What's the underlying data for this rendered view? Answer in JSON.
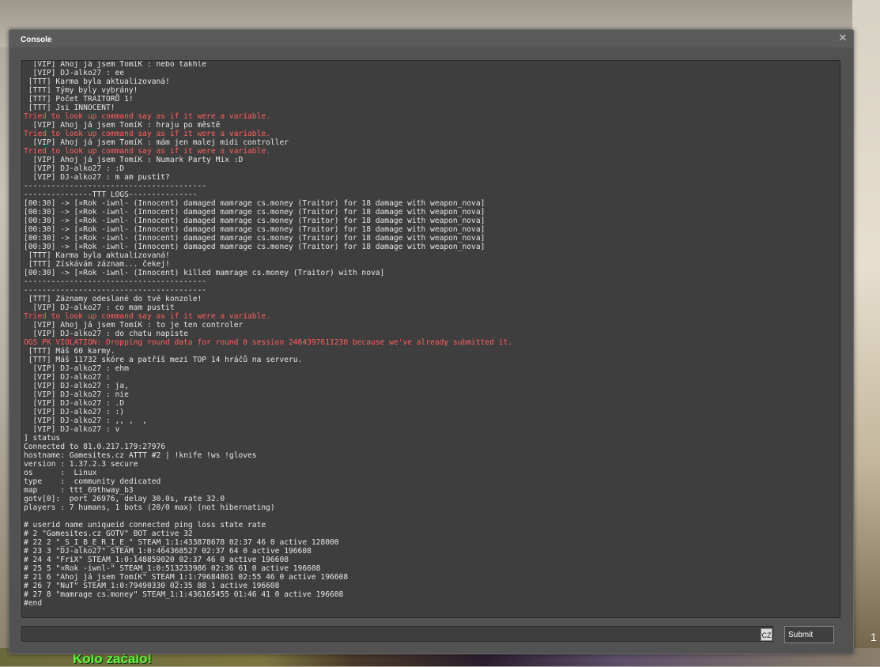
{
  "window": {
    "title": "Console",
    "close_glyph": "✕"
  },
  "console_lines": [
    {
      "text": "  [VIP] Ahoj já jsem TomíK : nebo takhle",
      "type": "normal"
    },
    {
      "text": "  [VIP] DJ-alko27 : ee",
      "type": "normal"
    },
    {
      "text": " [TTT] Karma byla aktualizovaná!",
      "type": "normal"
    },
    {
      "text": " [TTT] Týmy byly vybrány!",
      "type": "normal"
    },
    {
      "text": " [TTT] Počet TRAITORŮ 1!",
      "type": "normal"
    },
    {
      "text": " [TTT] Jsi INNOCENT!",
      "type": "normal"
    },
    {
      "text": "Tried to look up command say as if it were a variable.",
      "type": "error"
    },
    {
      "text": "  [VIP] Ahoj já jsem TomíK : hraju po městě",
      "type": "normal"
    },
    {
      "text": "Tried to look up command say as if it were a variable.",
      "type": "error"
    },
    {
      "text": "  [VIP] Ahoj já jsem TomíK : mám jen malej midi controller",
      "type": "normal"
    },
    {
      "text": "Tried to look up command say as if it were a variable.",
      "type": "error"
    },
    {
      "text": "  [VIP] Ahoj já jsem TomíK : Numark Party Mix :D",
      "type": "normal"
    },
    {
      "text": "  [VIP] DJ-alko27 : :D",
      "type": "normal"
    },
    {
      "text": "  [VIP] DJ-alko27 : m am pustit?",
      "type": "normal"
    },
    {
      "text": "----------------------------------------",
      "type": "normal"
    },
    {
      "text": "---------------TTT LOGS---------------",
      "type": "normal"
    },
    {
      "text": "[00:30] -> [¤Rok -iwnl- (Innocent) damaged mamrage cs.money (Traitor) for 18 damage with weapon_nova]",
      "type": "normal"
    },
    {
      "text": "[00:30] -> [¤Rok -iwnl- (Innocent) damaged mamrage cs.money (Traitor) for 18 damage with weapon_nova]",
      "type": "normal"
    },
    {
      "text": "[00:30] -> [¤Rok -iwnl- (Innocent) damaged mamrage cs.money (Traitor) for 18 damage with weapon_nova]",
      "type": "normal"
    },
    {
      "text": "[00:30] -> [¤Rok -iwnl- (Innocent) damaged mamrage cs.money (Traitor) for 18 damage with weapon_nova]",
      "type": "normal"
    },
    {
      "text": "[00:30] -> [¤Rok -iwnl- (Innocent) damaged mamrage cs.money (Traitor) for 18 damage with weapon_nova]",
      "type": "normal"
    },
    {
      "text": "[00:30] -> [¤Rok -iwnl- (Innocent) damaged mamrage cs.money (Traitor) for 18 damage with weapon_nova]",
      "type": "normal"
    },
    {
      "text": " [TTT] Karma byla aktualizovaná!",
      "type": "normal"
    },
    {
      "text": " [TTT] Získávám záznam... čekej!",
      "type": "normal"
    },
    {
      "text": "[00:30] -> [¤Rok -iwnl- (Innocent) killed mamrage cs.money (Traitor) with nova]",
      "type": "normal"
    },
    {
      "text": "----------------------------------------",
      "type": "normal"
    },
    {
      "text": "----------------------------------------",
      "type": "normal"
    },
    {
      "text": " [TTT] Záznamy odeslané do tvé konzole!",
      "type": "normal"
    },
    {
      "text": "  [VIP] DJ-alko27 : co mam pustit",
      "type": "normal"
    },
    {
      "text": "Tried to look up command say as if it were a variable.",
      "type": "error"
    },
    {
      "text": "  [VIP] Ahoj já jsem TomíK : to je ten controler",
      "type": "normal"
    },
    {
      "text": "  [VIP] DJ-alko27 : do chatu napiste",
      "type": "normal"
    },
    {
      "text": "OGS PK VIOLATION: Dropping round data for round 0 session 2464397611230 because we've already submitted it.",
      "type": "error"
    },
    {
      "text": " [TTT] Máš 60 karmy.",
      "type": "normal"
    },
    {
      "text": " [TTT] Máš 11732 skóre a patříš mezi TOP 14 hráčů na serveru.",
      "type": "normal"
    },
    {
      "text": "  [VIP] DJ-alko27 : ehm",
      "type": "normal"
    },
    {
      "text": "  [VIP] DJ-alko27 :",
      "type": "normal"
    },
    {
      "text": "  [VIP] DJ-alko27 : ja,",
      "type": "normal"
    },
    {
      "text": "  [VIP] DJ-alko27 : nie",
      "type": "normal"
    },
    {
      "text": "  [VIP] DJ-alko27 : .D",
      "type": "normal"
    },
    {
      "text": "  [VIP] DJ-alko27 : :)",
      "type": "normal"
    },
    {
      "text": "  [VIP] DJ-alko27 : ,, ,  ,",
      "type": "normal"
    },
    {
      "text": "  [VIP] DJ-alko27 : v",
      "type": "normal"
    },
    {
      "text": "] status",
      "type": "normal"
    },
    {
      "text": "Connected to 81.0.217.179:27976",
      "type": "normal"
    },
    {
      "text": "hostname: Gamesites.cz ATTT #2 | !knife !ws !gloves",
      "type": "normal"
    },
    {
      "text": "version : 1.37.2.3 secure",
      "type": "normal"
    },
    {
      "text": "os      :  Linux",
      "type": "normal"
    },
    {
      "text": "type    :  community dedicated",
      "type": "normal"
    },
    {
      "text": "map     : ttt_69thway_b3",
      "type": "normal"
    },
    {
      "text": "gotv[0]:  port 26976, delay 30.0s, rate 32.0",
      "type": "normal"
    },
    {
      "text": "players : 7 humans, 1 bots (20/0 max) (not hibernating)",
      "type": "normal"
    },
    {
      "text": "",
      "type": "normal"
    },
    {
      "text": "# userid name uniqueid connected ping loss state rate",
      "type": "normal"
    },
    {
      "text": "# 2 \"Gamesites.cz GOTV\" BOT active 32",
      "type": "normal"
    },
    {
      "text": "# 22 2 \"_S_I_B_E_R_I_E_\" STEAM_1:1:433878678 02:37 46 0 active 128000",
      "type": "normal"
    },
    {
      "text": "# 23 3 \"DJ-alko27\" STEAM_1:0:464368527 02:37 64 0 active 196608",
      "type": "normal"
    },
    {
      "text": "# 24 4 \"FriX\" STEAM_1:0:148859020 02:37 46 0 active 196608",
      "type": "normal"
    },
    {
      "text": "# 25 5 \"¤Rok -iwnl-\" STEAM_1:0:513233986 02:36 61 0 active 196608",
      "type": "normal"
    },
    {
      "text": "# 21 6 \"Ahoj já jsem TomíK\" STEAM_1:1:79684861 02:55 46 0 active 196608",
      "type": "normal"
    },
    {
      "text": "# 26 7 \"NuT\" STEAM_1:0:79490330 02:35 88 1 active 196608",
      "type": "normal"
    },
    {
      "text": "# 27 8 \"mamrage cs.money\" STEAM_1:1:436165455 01:46 41 0 active 196608",
      "type": "normal"
    },
    {
      "text": "#end",
      "type": "normal"
    }
  ],
  "input": {
    "value": "",
    "placeholder": ""
  },
  "language_indicator": "CZ",
  "submit_label": "Submit",
  "hud": {
    "round_message": "Kolo začalo!",
    "side_number": "1"
  },
  "colors": {
    "error": "#ff5f5f",
    "text": "#e6e6e6",
    "round_message": "#5dff3a"
  }
}
